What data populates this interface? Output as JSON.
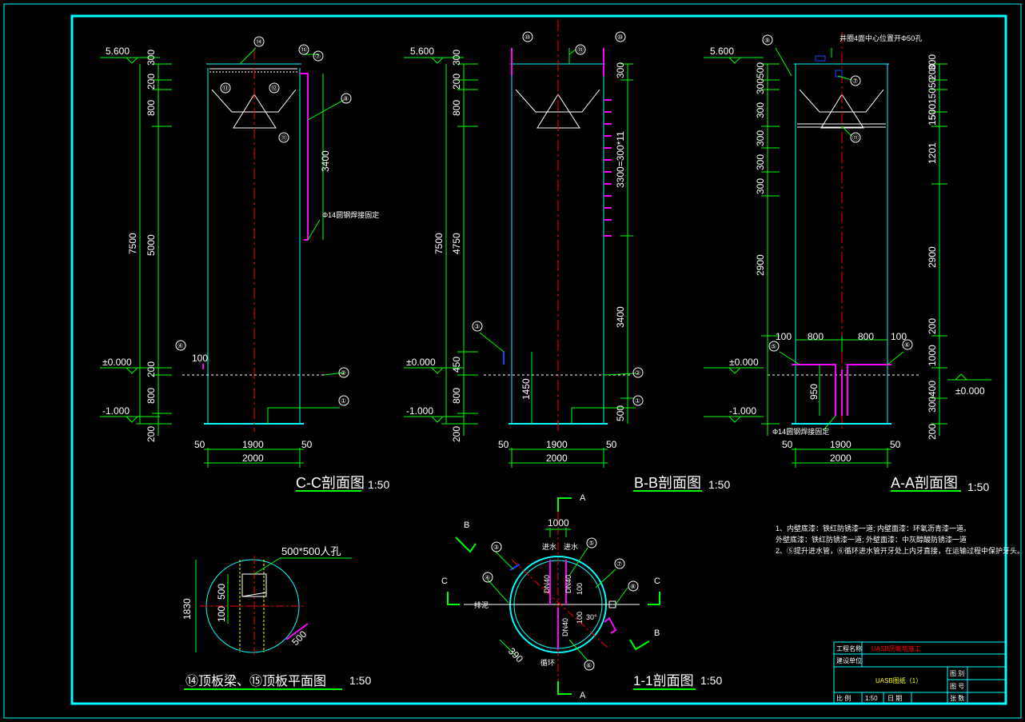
{
  "colors": {
    "frame": "#00ffff",
    "green": "#00ff00",
    "red": "#ff0000",
    "magenta": "#ff00ff",
    "white": "#ffffff",
    "yellow": "#ffff00",
    "blue": "#2040ff"
  },
  "views": {
    "cc": {
      "title": "C-C剖面图",
      "scale": "1:50",
      "annotation": "Φ14圆钢焊接固定",
      "dims_left": [
        "300",
        "200",
        "800",
        "5000",
        "200",
        "800",
        "200"
      ],
      "overall": "7500",
      "lower": "100",
      "right": "3400",
      "width": "1900",
      "total": "2000",
      "edge_l": "50",
      "edge_r": "50",
      "circles": [
        "⑭",
        "⑮",
        "⑦",
        "⑬",
        "⑫",
        "⑧",
        "⑪",
        "④",
        "②",
        "①"
      ]
    },
    "bb": {
      "title": "B-B剖面图",
      "scale": "1:50",
      "dims_left": [
        "300",
        "200",
        "800",
        "4750",
        "450",
        "800",
        "200"
      ],
      "overall": "7500",
      "inner": "1450",
      "right": [
        "300",
        "3300=300*11",
        "3400",
        "500"
      ],
      "width": "1900",
      "total": "2000",
      "edge_l": "50",
      "edge_r": "50",
      "circles": [
        "⑩",
        "⑩",
        "⑮",
        "③",
        "②",
        "①"
      ]
    },
    "aa": {
      "title": "A-A剖面图",
      "scale": "1:50",
      "top_note": "井圈4面中心位置开Φ50孔",
      "annotation": "Φ14圆钢焊接固定",
      "dims_left": [
        "300",
        "300",
        "300",
        "300",
        "300",
        "300",
        "2900"
      ],
      "top_small": "500",
      "dims_right": [
        "200",
        "50",
        "300",
        "150",
        "500",
        "150",
        "1201",
        "2900",
        "200",
        "1000",
        "400",
        "300",
        "200"
      ],
      "lower": [
        "100",
        "800",
        "800",
        "100"
      ],
      "depth": "950",
      "ref": "±0.000",
      "width": "1900",
      "total": "2000",
      "edge_l": "50",
      "edge_r": "50",
      "circles": [
        "⑨",
        "⑦",
        "⑪",
        "⑤",
        "⑥"
      ]
    },
    "plan14": {
      "title": "⑭顶板梁、⑮顶板平面图",
      "scale": "1:50",
      "hole": "500*500人孔",
      "dims": [
        "1830",
        "500",
        "100",
        "500"
      ]
    },
    "plan11": {
      "title": "1-1剖面图",
      "scale": "1:50",
      "top": "1000",
      "sections": [
        "A",
        "A",
        "B",
        "B",
        "C",
        "C"
      ],
      "pipes": [
        "DN40",
        "DN40",
        "DN40",
        "100",
        "100",
        "30°"
      ],
      "labels": [
        "进水",
        "进水",
        "排泥",
        "循环"
      ],
      "dim": "390",
      "circles": [
        "③",
        "④",
        "⑤",
        "⑦",
        "⑧",
        "⑥"
      ]
    }
  },
  "levels": {
    "top": "5.600",
    "zero": "±0.000",
    "bottom": "-1.000"
  },
  "notes": [
    "1、内壁底漆：铁红防锈漆一道;      内壁面漆：环氧沥青漆一道。",
    "    外壁底漆：铁红防锈漆一道;      外壁面漆：中灰醇酸防锈漆一道",
    "2、⑤提升进水管，⑥循环进水管开牙处上内牙直接，在运输过程中保护牙头。"
  ],
  "title_block": {
    "project_label": "工程名称",
    "project_value": "UASB厌氧塔施工",
    "unit_label": "建设单位",
    "drawing_name": "UASB图纸（1）",
    "fig_cat": "图 别",
    "fig_no": "图 号",
    "scale_label": "比 例",
    "scale_value": "1:50",
    "date_label": "日 期",
    "sheet_label": "张 数"
  }
}
